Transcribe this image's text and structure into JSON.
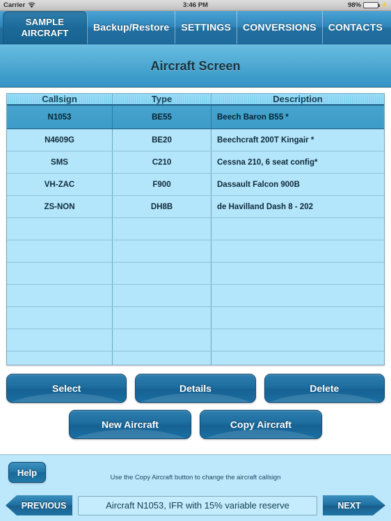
{
  "statusbar": {
    "carrier": "Carrier",
    "wifi_icon": "wifi-icon",
    "time": "3:46 PM",
    "battery_percent": "98%",
    "battery_level": 98,
    "charging_icon": "lightning-bolt-icon"
  },
  "tabs": [
    {
      "label": "SAMPLE AIRCRAFT",
      "line1": "SAMPLE",
      "line2": "AIRCRAFT",
      "selected": true
    },
    {
      "label": "Backup/Restore",
      "selected": false
    },
    {
      "label": "SETTINGS",
      "selected": false
    },
    {
      "label": "CONVERSIONS",
      "selected": false
    },
    {
      "label": "CONTACTS",
      "selected": false
    }
  ],
  "header": {
    "title": "Aircraft Screen"
  },
  "table": {
    "columns": [
      "Callsign",
      "Type",
      "Description"
    ],
    "rows": [
      {
        "callsign": "N1053",
        "type": "BE55",
        "description": "Beech Baron B55 *",
        "selected": true
      },
      {
        "callsign": "N4609G",
        "type": "BE20",
        "description": "Beechcraft 200T Kingair *",
        "selected": false
      },
      {
        "callsign": "SMS",
        "type": "C210",
        "description": "Cessna 210, 6 seat config*",
        "selected": false
      },
      {
        "callsign": "VH-ZAC",
        "type": "F900",
        "description": "Dassault Falcon 900B",
        "selected": false
      },
      {
        "callsign": "ZS-NON",
        "type": "DH8B",
        "description": "de Havilland Dash 8 - 202",
        "selected": false
      }
    ],
    "empty_row_count": 7
  },
  "actions": {
    "select": "Select",
    "details": "Details",
    "delete": "Delete",
    "new_aircraft": "New Aircraft",
    "copy_aircraft": "Copy Aircraft"
  },
  "footer": {
    "help": "Help",
    "hint": "Use the Copy Aircraft button to change the aircraft callsign",
    "previous": "PREVIOUS",
    "next": "NEXT",
    "status_value": "Aircraft N1053, IFR with 15% variable reserve"
  },
  "colors": {
    "accent": "#1d6d9f",
    "table_bg": "#b3e5fb",
    "selected_row": "#3d9cc8",
    "title_bar": "#55aed6",
    "footer_bg": "#bde7fb"
  }
}
